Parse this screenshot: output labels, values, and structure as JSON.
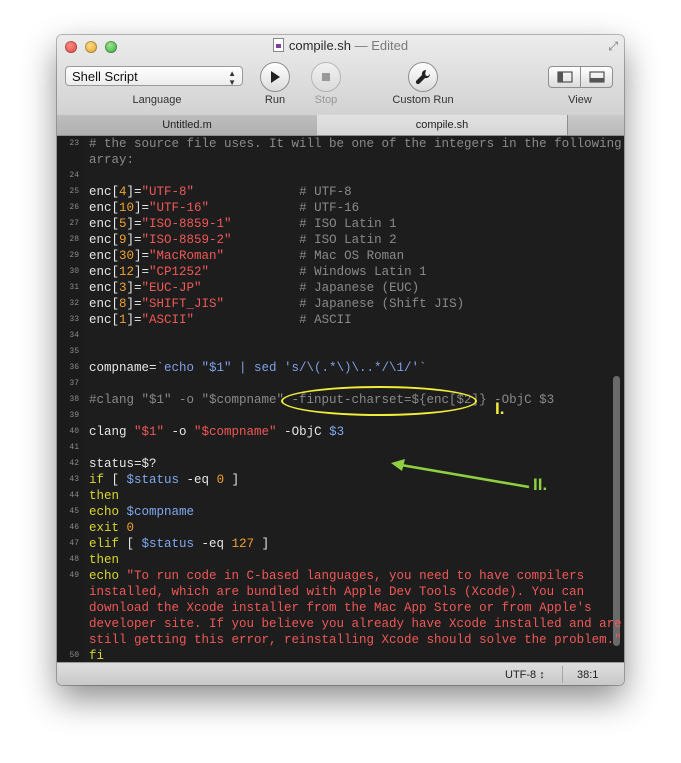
{
  "window": {
    "title": "compile.sh",
    "title_status": "— Edited"
  },
  "toolbar": {
    "language_value": "Shell Script",
    "language_label": "Language",
    "run_label": "Run",
    "stop_label": "Stop",
    "custom_run_label": "Custom Run",
    "view_label": "View"
  },
  "tabs": [
    {
      "label": "Untitled.m",
      "active": false
    },
    {
      "label": "compile.sh",
      "active": true
    }
  ],
  "code_lines": [
    {
      "num": "23",
      "tokens": [
        {
          "t": "# the source file uses. It will be one of the integers in the following",
          "c": "c-comment"
        }
      ]
    },
    {
      "num": "",
      "tokens": [
        {
          "t": "array:",
          "c": "c-comment"
        }
      ]
    },
    {
      "num": "24",
      "tokens": []
    },
    {
      "num": "25",
      "tokens": [
        {
          "t": "enc[",
          "c": "c-var"
        },
        {
          "t": "4",
          "c": "c-num"
        },
        {
          "t": "]=",
          "c": "c-var"
        },
        {
          "t": "\"UTF-8\"",
          "c": "c-str"
        },
        {
          "t": "              # UTF-8",
          "c": "c-comment"
        }
      ]
    },
    {
      "num": "26",
      "tokens": [
        {
          "t": "enc[",
          "c": "c-var"
        },
        {
          "t": "10",
          "c": "c-num"
        },
        {
          "t": "]=",
          "c": "c-var"
        },
        {
          "t": "\"UTF-16\"",
          "c": "c-str"
        },
        {
          "t": "            # UTF-16",
          "c": "c-comment"
        }
      ]
    },
    {
      "num": "27",
      "tokens": [
        {
          "t": "enc[",
          "c": "c-var"
        },
        {
          "t": "5",
          "c": "c-num"
        },
        {
          "t": "]=",
          "c": "c-var"
        },
        {
          "t": "\"ISO-8859-1\"",
          "c": "c-str"
        },
        {
          "t": "         # ISO Latin 1",
          "c": "c-comment"
        }
      ]
    },
    {
      "num": "28",
      "tokens": [
        {
          "t": "enc[",
          "c": "c-var"
        },
        {
          "t": "9",
          "c": "c-num"
        },
        {
          "t": "]=",
          "c": "c-var"
        },
        {
          "t": "\"ISO-8859-2\"",
          "c": "c-str"
        },
        {
          "t": "         # ISO Latin 2",
          "c": "c-comment"
        }
      ]
    },
    {
      "num": "29",
      "tokens": [
        {
          "t": "enc[",
          "c": "c-var"
        },
        {
          "t": "30",
          "c": "c-num"
        },
        {
          "t": "]=",
          "c": "c-var"
        },
        {
          "t": "\"MacRoman\"",
          "c": "c-str"
        },
        {
          "t": "          # Mac OS Roman",
          "c": "c-comment"
        }
      ]
    },
    {
      "num": "30",
      "tokens": [
        {
          "t": "enc[",
          "c": "c-var"
        },
        {
          "t": "12",
          "c": "c-num"
        },
        {
          "t": "]=",
          "c": "c-var"
        },
        {
          "t": "\"CP1252\"",
          "c": "c-str"
        },
        {
          "t": "            # Windows Latin 1",
          "c": "c-comment"
        }
      ]
    },
    {
      "num": "31",
      "tokens": [
        {
          "t": "enc[",
          "c": "c-var"
        },
        {
          "t": "3",
          "c": "c-num"
        },
        {
          "t": "]=",
          "c": "c-var"
        },
        {
          "t": "\"EUC-JP\"",
          "c": "c-str"
        },
        {
          "t": "             # Japanese (EUC)",
          "c": "c-comment"
        }
      ]
    },
    {
      "num": "32",
      "tokens": [
        {
          "t": "enc[",
          "c": "c-var"
        },
        {
          "t": "8",
          "c": "c-num"
        },
        {
          "t": "]=",
          "c": "c-var"
        },
        {
          "t": "\"SHIFT_JIS\"",
          "c": "c-str"
        },
        {
          "t": "          # Japanese (Shift JIS)",
          "c": "c-comment"
        }
      ]
    },
    {
      "num": "33",
      "tokens": [
        {
          "t": "enc[",
          "c": "c-var"
        },
        {
          "t": "1",
          "c": "c-num"
        },
        {
          "t": "]=",
          "c": "c-var"
        },
        {
          "t": "\"ASCII\"",
          "c": "c-str"
        },
        {
          "t": "              # ASCII",
          "c": "c-comment"
        }
      ]
    },
    {
      "num": "34",
      "tokens": []
    },
    {
      "num": "35",
      "tokens": []
    },
    {
      "num": "36",
      "tokens": [
        {
          "t": "compname=",
          "c": "c-var"
        },
        {
          "t": "`echo \"$1\" | sed 's/\\(.*\\)\\..*/\\1/'`",
          "c": "c-sh"
        }
      ]
    },
    {
      "num": "37",
      "tokens": []
    },
    {
      "num": "38",
      "tokens": [
        {
          "t": "#clang \"$1\" -o \"$compname\" -finput-charset=${enc[$2]} -ObjC $3",
          "c": "c-comment"
        }
      ]
    },
    {
      "num": "39",
      "tokens": []
    },
    {
      "num": "40",
      "tokens": [
        {
          "t": "clang ",
          "c": "c-var"
        },
        {
          "t": "\"$1\"",
          "c": "c-str"
        },
        {
          "t": " -o ",
          "c": "c-var"
        },
        {
          "t": "\"$compname\"",
          "c": "c-str"
        },
        {
          "t": " -ObjC ",
          "c": "c-var"
        },
        {
          "t": "$3",
          "c": "c-blue"
        }
      ]
    },
    {
      "num": "41",
      "tokens": []
    },
    {
      "num": "42",
      "tokens": [
        {
          "t": "status=$?",
          "c": "c-var"
        }
      ]
    },
    {
      "num": "43",
      "tokens": [
        {
          "t": "if",
          "c": "c-kw"
        },
        {
          "t": " [ ",
          "c": "c-var"
        },
        {
          "t": "$status",
          "c": "c-blue"
        },
        {
          "t": " -eq ",
          "c": "c-var"
        },
        {
          "t": "0",
          "c": "c-num"
        },
        {
          "t": " ]",
          "c": "c-var"
        }
      ]
    },
    {
      "num": "44",
      "tokens": [
        {
          "t": "then",
          "c": "c-kw"
        }
      ]
    },
    {
      "num": "45",
      "tokens": [
        {
          "t": "echo ",
          "c": "c-kw"
        },
        {
          "t": "$compname",
          "c": "c-blue"
        }
      ]
    },
    {
      "num": "46",
      "tokens": [
        {
          "t": "exit ",
          "c": "c-kw"
        },
        {
          "t": "0",
          "c": "c-num"
        }
      ]
    },
    {
      "num": "47",
      "tokens": [
        {
          "t": "elif",
          "c": "c-kw"
        },
        {
          "t": " [ ",
          "c": "c-var"
        },
        {
          "t": "$status",
          "c": "c-blue"
        },
        {
          "t": " -eq ",
          "c": "c-var"
        },
        {
          "t": "127",
          "c": "c-num"
        },
        {
          "t": " ]",
          "c": "c-var"
        }
      ]
    },
    {
      "num": "48",
      "tokens": [
        {
          "t": "then",
          "c": "c-kw"
        }
      ]
    },
    {
      "num": "49",
      "tokens": [
        {
          "t": "echo ",
          "c": "c-kw"
        },
        {
          "t": "\"To run code in C-based languages, you need to have compilers",
          "c": "c-str"
        }
      ]
    },
    {
      "num": "",
      "tokens": [
        {
          "t": "installed, which are bundled with Apple Dev Tools (Xcode). You can",
          "c": "c-str"
        }
      ]
    },
    {
      "num": "",
      "tokens": [
        {
          "t": "download the Xcode installer from the Mac App Store or from Apple's",
          "c": "c-str"
        }
      ]
    },
    {
      "num": "",
      "tokens": [
        {
          "t": "developer site. If you believe you already have Xcode installed and are",
          "c": "c-str"
        }
      ]
    },
    {
      "num": "",
      "tokens": [
        {
          "t": "still getting this error, reinstalling Xcode should solve the problem.\"",
          "c": "c-str"
        }
      ]
    },
    {
      "num": "50",
      "tokens": [
        {
          "t": "fi",
          "c": "c-kw"
        }
      ]
    }
  ],
  "annotations": {
    "label_one": "I.",
    "label_two": "II."
  },
  "statusbar": {
    "encoding": "UTF-8",
    "position": "38:1"
  }
}
